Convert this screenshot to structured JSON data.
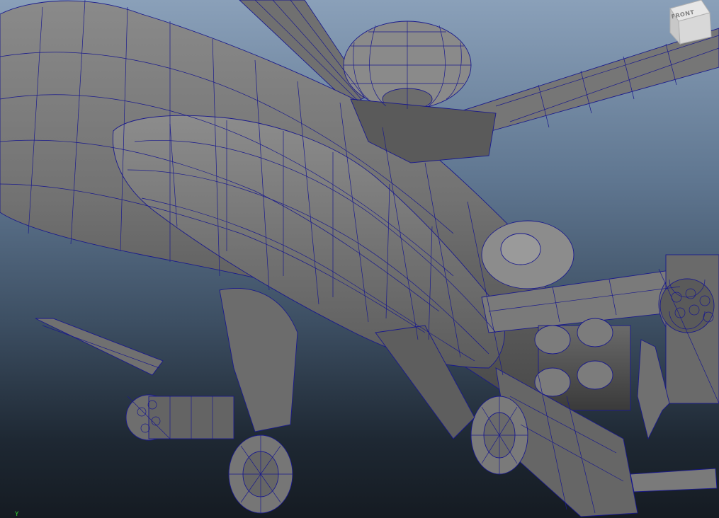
{
  "viewport": {
    "camera_label": "",
    "background_top": "#8aa0b9",
    "background_bottom": "#151b22"
  },
  "model": {
    "mesh_color": "#6e6e6e",
    "wire_color": "#1a1a8c",
    "display_mode": "wireframe-on-shaded"
  },
  "view_cube": {
    "face_label": "FRONT",
    "icon": "view-cube-icon"
  },
  "axis_indicator": {
    "label": "Y",
    "color": "#31d431"
  }
}
